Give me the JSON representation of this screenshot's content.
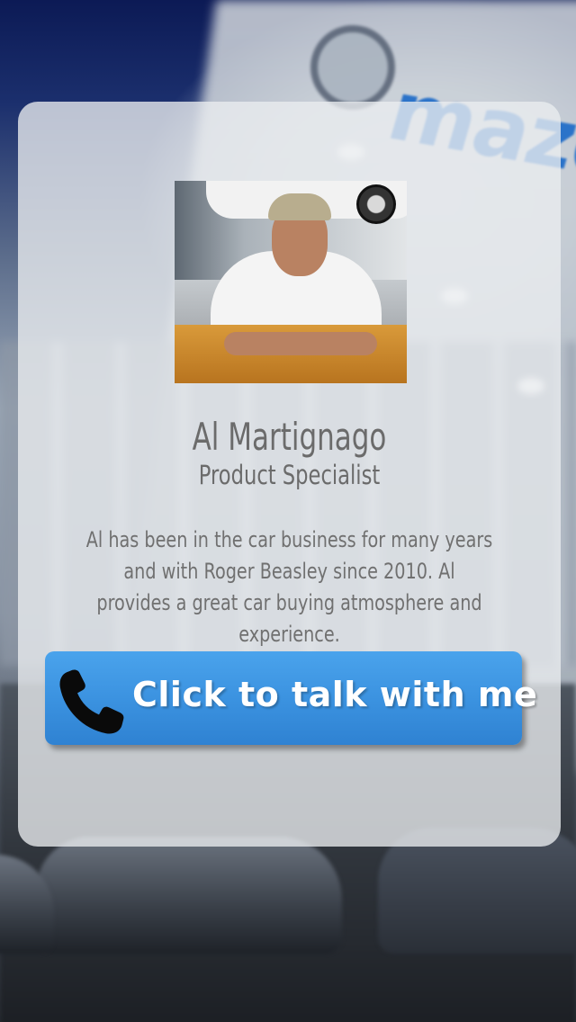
{
  "background": {
    "brand_wordmark": "mazda"
  },
  "profile": {
    "name": "Al Martignago",
    "title": "Product Specialist",
    "bio": "Al has been in the car business for many years and with Roger Beasley since 2010. Al provides a great car buying atmosphere and experience."
  },
  "cta": {
    "label": "Click to talk with me",
    "icon": "phone-icon",
    "color": "#3a91df"
  }
}
